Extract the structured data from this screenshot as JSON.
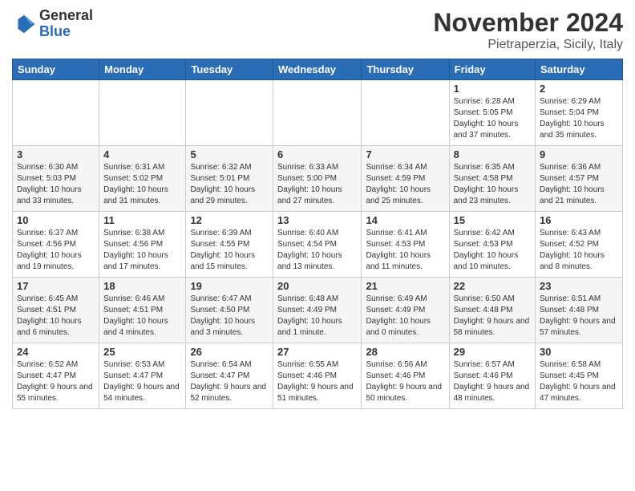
{
  "logo": {
    "general": "General",
    "blue": "Blue"
  },
  "title": "November 2024",
  "location": "Pietraperzia, Sicily, Italy",
  "days_header": [
    "Sunday",
    "Monday",
    "Tuesday",
    "Wednesday",
    "Thursday",
    "Friday",
    "Saturday"
  ],
  "weeks": [
    [
      {
        "day": "",
        "info": ""
      },
      {
        "day": "",
        "info": ""
      },
      {
        "day": "",
        "info": ""
      },
      {
        "day": "",
        "info": ""
      },
      {
        "day": "",
        "info": ""
      },
      {
        "day": "1",
        "info": "Sunrise: 6:28 AM\nSunset: 5:05 PM\nDaylight: 10 hours and 37 minutes."
      },
      {
        "day": "2",
        "info": "Sunrise: 6:29 AM\nSunset: 5:04 PM\nDaylight: 10 hours and 35 minutes."
      }
    ],
    [
      {
        "day": "3",
        "info": "Sunrise: 6:30 AM\nSunset: 5:03 PM\nDaylight: 10 hours and 33 minutes."
      },
      {
        "day": "4",
        "info": "Sunrise: 6:31 AM\nSunset: 5:02 PM\nDaylight: 10 hours and 31 minutes."
      },
      {
        "day": "5",
        "info": "Sunrise: 6:32 AM\nSunset: 5:01 PM\nDaylight: 10 hours and 29 minutes."
      },
      {
        "day": "6",
        "info": "Sunrise: 6:33 AM\nSunset: 5:00 PM\nDaylight: 10 hours and 27 minutes."
      },
      {
        "day": "7",
        "info": "Sunrise: 6:34 AM\nSunset: 4:59 PM\nDaylight: 10 hours and 25 minutes."
      },
      {
        "day": "8",
        "info": "Sunrise: 6:35 AM\nSunset: 4:58 PM\nDaylight: 10 hours and 23 minutes."
      },
      {
        "day": "9",
        "info": "Sunrise: 6:36 AM\nSunset: 4:57 PM\nDaylight: 10 hours and 21 minutes."
      }
    ],
    [
      {
        "day": "10",
        "info": "Sunrise: 6:37 AM\nSunset: 4:56 PM\nDaylight: 10 hours and 19 minutes."
      },
      {
        "day": "11",
        "info": "Sunrise: 6:38 AM\nSunset: 4:56 PM\nDaylight: 10 hours and 17 minutes."
      },
      {
        "day": "12",
        "info": "Sunrise: 6:39 AM\nSunset: 4:55 PM\nDaylight: 10 hours and 15 minutes."
      },
      {
        "day": "13",
        "info": "Sunrise: 6:40 AM\nSunset: 4:54 PM\nDaylight: 10 hours and 13 minutes."
      },
      {
        "day": "14",
        "info": "Sunrise: 6:41 AM\nSunset: 4:53 PM\nDaylight: 10 hours and 11 minutes."
      },
      {
        "day": "15",
        "info": "Sunrise: 6:42 AM\nSunset: 4:53 PM\nDaylight: 10 hours and 10 minutes."
      },
      {
        "day": "16",
        "info": "Sunrise: 6:43 AM\nSunset: 4:52 PM\nDaylight: 10 hours and 8 minutes."
      }
    ],
    [
      {
        "day": "17",
        "info": "Sunrise: 6:45 AM\nSunset: 4:51 PM\nDaylight: 10 hours and 6 minutes."
      },
      {
        "day": "18",
        "info": "Sunrise: 6:46 AM\nSunset: 4:51 PM\nDaylight: 10 hours and 4 minutes."
      },
      {
        "day": "19",
        "info": "Sunrise: 6:47 AM\nSunset: 4:50 PM\nDaylight: 10 hours and 3 minutes."
      },
      {
        "day": "20",
        "info": "Sunrise: 6:48 AM\nSunset: 4:49 PM\nDaylight: 10 hours and 1 minute."
      },
      {
        "day": "21",
        "info": "Sunrise: 6:49 AM\nSunset: 4:49 PM\nDaylight: 10 hours and 0 minutes."
      },
      {
        "day": "22",
        "info": "Sunrise: 6:50 AM\nSunset: 4:48 PM\nDaylight: 9 hours and 58 minutes."
      },
      {
        "day": "23",
        "info": "Sunrise: 6:51 AM\nSunset: 4:48 PM\nDaylight: 9 hours and 57 minutes."
      }
    ],
    [
      {
        "day": "24",
        "info": "Sunrise: 6:52 AM\nSunset: 4:47 PM\nDaylight: 9 hours and 55 minutes."
      },
      {
        "day": "25",
        "info": "Sunrise: 6:53 AM\nSunset: 4:47 PM\nDaylight: 9 hours and 54 minutes."
      },
      {
        "day": "26",
        "info": "Sunrise: 6:54 AM\nSunset: 4:47 PM\nDaylight: 9 hours and 52 minutes."
      },
      {
        "day": "27",
        "info": "Sunrise: 6:55 AM\nSunset: 4:46 PM\nDaylight: 9 hours and 51 minutes."
      },
      {
        "day": "28",
        "info": "Sunrise: 6:56 AM\nSunset: 4:46 PM\nDaylight: 9 hours and 50 minutes."
      },
      {
        "day": "29",
        "info": "Sunrise: 6:57 AM\nSunset: 4:46 PM\nDaylight: 9 hours and 48 minutes."
      },
      {
        "day": "30",
        "info": "Sunrise: 6:58 AM\nSunset: 4:45 PM\nDaylight: 9 hours and 47 minutes."
      }
    ]
  ]
}
